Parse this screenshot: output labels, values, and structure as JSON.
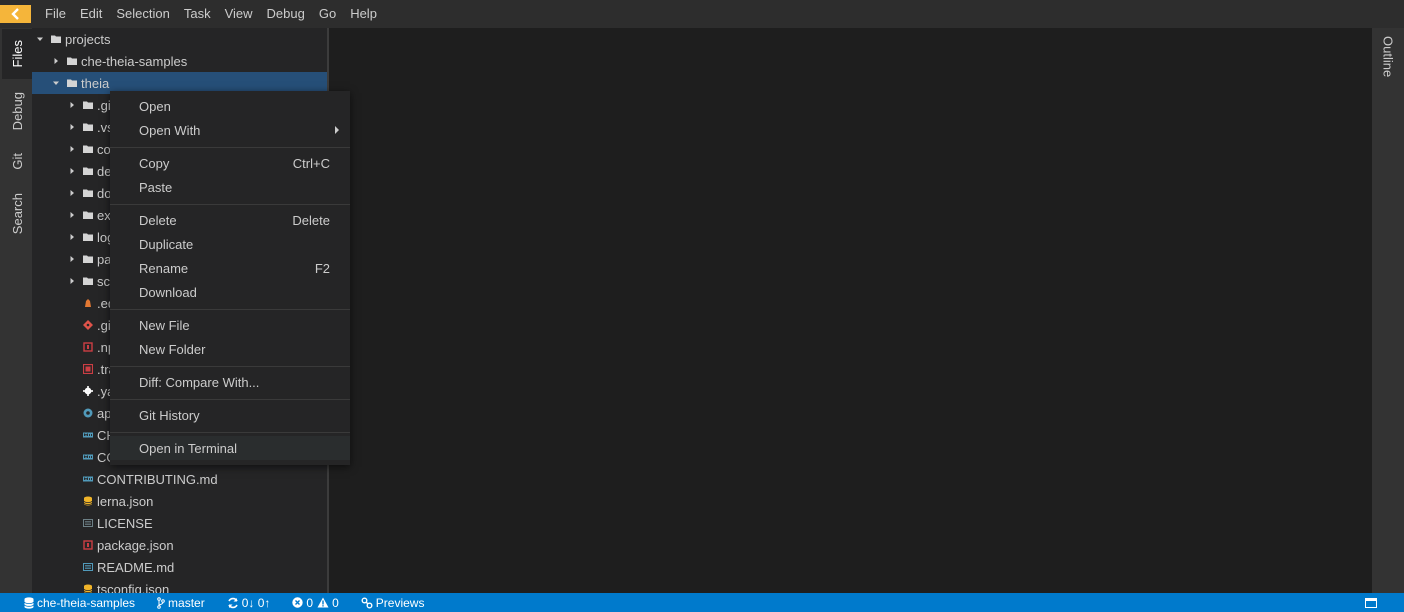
{
  "menubar": {
    "items": [
      "File",
      "Edit",
      "Selection",
      "Task",
      "View",
      "Debug",
      "Go",
      "Help"
    ]
  },
  "left_tabs": [
    "Files",
    "Debug",
    "Git",
    "Search"
  ],
  "right_tabs": [
    "Outline"
  ],
  "tree": {
    "projects": "projects",
    "che_theia_samples": "che-theia-samples",
    "theia": "theia",
    "folders": [
      ".gi",
      ".vs",
      "co",
      "de",
      "do",
      "ex",
      "log",
      "pa",
      "sc"
    ],
    "files": [
      {
        "name": ".ed",
        "icon": "editorconfig-icon"
      },
      {
        "name": ".gi",
        "icon": "git-icon"
      },
      {
        "name": ".np",
        "icon": "npm-icon"
      },
      {
        "name": ".tra",
        "icon": "travis-icon"
      },
      {
        "name": ".ya",
        "icon": "gear-icon"
      },
      {
        "name": "ap",
        "icon": "appveyor-icon"
      },
      {
        "name": "CH",
        "icon": "markdown-icon"
      },
      {
        "name": "CO",
        "icon": "markdown-icon"
      },
      {
        "name": "CONTRIBUTING.md",
        "icon": "markdown-icon"
      },
      {
        "name": "lerna.json",
        "icon": "json-db-icon"
      },
      {
        "name": "LICENSE",
        "icon": "license-icon"
      },
      {
        "name": "package.json",
        "icon": "npm-icon"
      },
      {
        "name": "README.md",
        "icon": "readme-icon"
      },
      {
        "name": "tsconfig.json",
        "icon": "json-db-icon"
      }
    ]
  },
  "context_menu": {
    "open": "Open",
    "open_with": "Open With",
    "copy": "Copy",
    "copy_key": "Ctrl+C",
    "paste": "Paste",
    "delete": "Delete",
    "delete_key": "Delete",
    "duplicate": "Duplicate",
    "rename": "Rename",
    "rename_key": "F2",
    "download": "Download",
    "new_file": "New File",
    "new_folder": "New Folder",
    "diff": "Diff: Compare With...",
    "git_history": "Git History",
    "open_terminal": "Open in Terminal"
  },
  "statusbar": {
    "workspace": "che-theia-samples",
    "branch": "master",
    "sync": "0↓ 0↑",
    "errors": "0",
    "warnings": "0",
    "previews": "Previews"
  },
  "colors": {
    "accent": "#007acc",
    "back_button": "#f5b53a",
    "selection": "#264f78"
  }
}
